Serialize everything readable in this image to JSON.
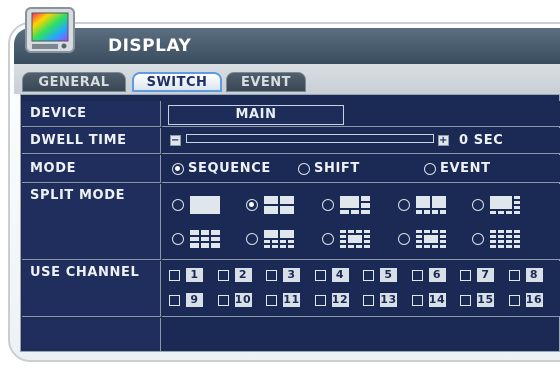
{
  "window": {
    "title": "DISPLAY",
    "icon": "monitor-icon"
  },
  "tabs": [
    {
      "label": "GENERAL",
      "active": false
    },
    {
      "label": "SWITCH",
      "active": true
    },
    {
      "label": "EVENT",
      "active": false
    }
  ],
  "device": {
    "label": "DEVICE",
    "value": "MAIN"
  },
  "dwell_time": {
    "label": "DWELL TIME",
    "value": "0 SEC",
    "minus": "−",
    "plus": "+"
  },
  "mode": {
    "label": "MODE",
    "options": [
      {
        "label": "SEQUENCE",
        "selected": true
      },
      {
        "label": "SHIFT",
        "selected": false
      },
      {
        "label": "EVENT",
        "selected": false
      }
    ]
  },
  "split_mode": {
    "label": "SPLIT MODE",
    "selected_index": 1,
    "layouts": [
      "full",
      "quad",
      "six",
      "eight-a",
      "eight-b",
      "nine",
      "ten",
      "thirteen",
      "thirteen-b",
      "sixteen"
    ]
  },
  "use_channel": {
    "label": "USE CHANNEL",
    "channels": [
      "1",
      "2",
      "3",
      "4",
      "5",
      "6",
      "7",
      "8",
      "9",
      "10",
      "11",
      "12",
      "13",
      "14",
      "15",
      "16"
    ]
  }
}
